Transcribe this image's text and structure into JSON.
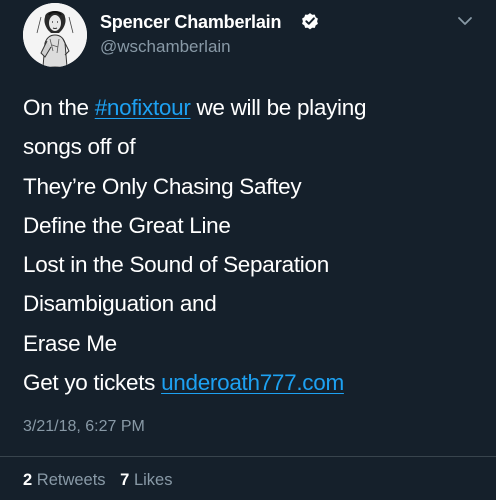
{
  "tweet": {
    "author": {
      "display_name": "Spencer Chamberlain",
      "handle": "@wschamberlain",
      "verified": true
    },
    "body": {
      "line1_prefix": "On the ",
      "hashtag": "#nofixtour",
      "line1_suffix": " we will be playing",
      "line2": "songs off of",
      "line3": "They’re Only Chasing Saftey",
      "line4": "Define the Great Line",
      "line5": "Lost in the Sound of Separation",
      "line6": "Disambiguation and",
      "line7": "Erase Me",
      "line8_prefix": "Get yo tickets ",
      "link": "underoath777.com"
    },
    "timestamp": "3/21/18, 6:27 PM",
    "stats": {
      "retweets_count": "2",
      "retweets_label": "Retweets",
      "likes_count": "7",
      "likes_label": "Likes"
    }
  },
  "colors": {
    "background": "#15202b",
    "text": "#ffffff",
    "secondary_text": "#8899a6",
    "link": "#1da1f2",
    "divider": "#38444d"
  },
  "icons": {
    "verified": "verified-badge-icon",
    "menu": "chevron-down-icon",
    "avatar": "profile-photo"
  }
}
